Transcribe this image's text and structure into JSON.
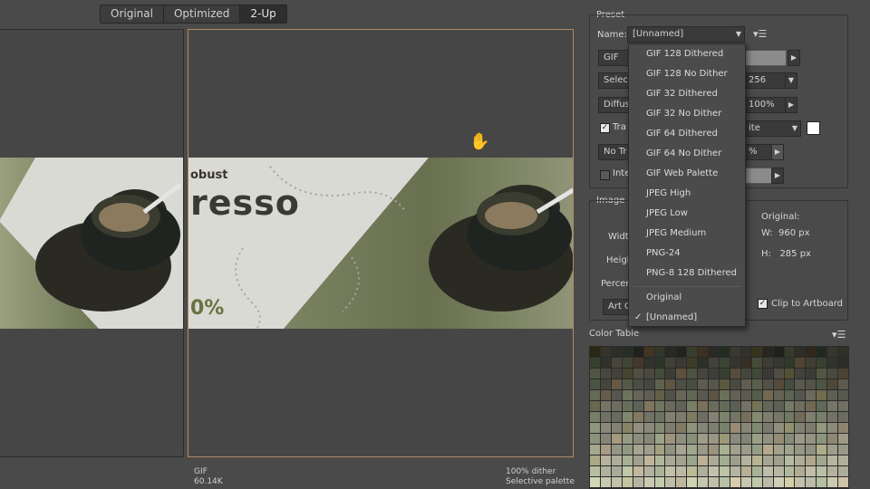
{
  "view_tabs": [
    {
      "label": "Original",
      "active": false
    },
    {
      "label": "Optimized",
      "active": false
    },
    {
      "label": "2-Up",
      "active": true
    }
  ],
  "left_pane": {
    "banner_text_1": "obust",
    "banner_text_2": "resso",
    "banner_text_3": "0%"
  },
  "right_pane": {
    "format": "GIF",
    "size": "60.14K",
    "dither": "100% dither",
    "palette": "Selective palette"
  },
  "preset": {
    "section_label": "Preset",
    "name_label": "Name:",
    "name_value": "[Unnamed]",
    "format_value": "GIF",
    "reduction_value": "Selec",
    "colors_value": "256",
    "dither_method": "Diffus",
    "dither_value": "100%",
    "transparency_label": "Tra",
    "matte_value": "ite",
    "transparency_dither": "No Tr",
    "transparency_amount": "%",
    "interlaced_label": "Inte"
  },
  "menu": {
    "items": [
      "GIF 128 Dithered",
      "GIF 128 No Dither",
      "GIF 32 Dithered",
      "GIF 32 No Dither",
      "GIF 64 Dithered",
      "GIF 64 No Dither",
      "GIF Web Palette",
      "JPEG High",
      "JPEG Low",
      "JPEG Medium",
      "PNG-24",
      "PNG-8 128 Dithered"
    ],
    "items2": [
      "Original",
      "[Unnamed]"
    ],
    "checked": "[Unnamed]"
  },
  "image_size": {
    "section_label": "Image S",
    "width_label": "Widt",
    "height_label": "Heigh",
    "percent_label": "Percen",
    "art_label": "Art O",
    "original_label": "Original:",
    "w_label": "W:",
    "w_value": "960 px",
    "h_label": "H:",
    "h_value": "285 px",
    "clip_label": "Clip to Artboard"
  },
  "color_table": {
    "section_label": "Color Table"
  },
  "colors": {
    "accent_border": "#b08a64",
    "panel_bg": "#4a4a4a"
  }
}
